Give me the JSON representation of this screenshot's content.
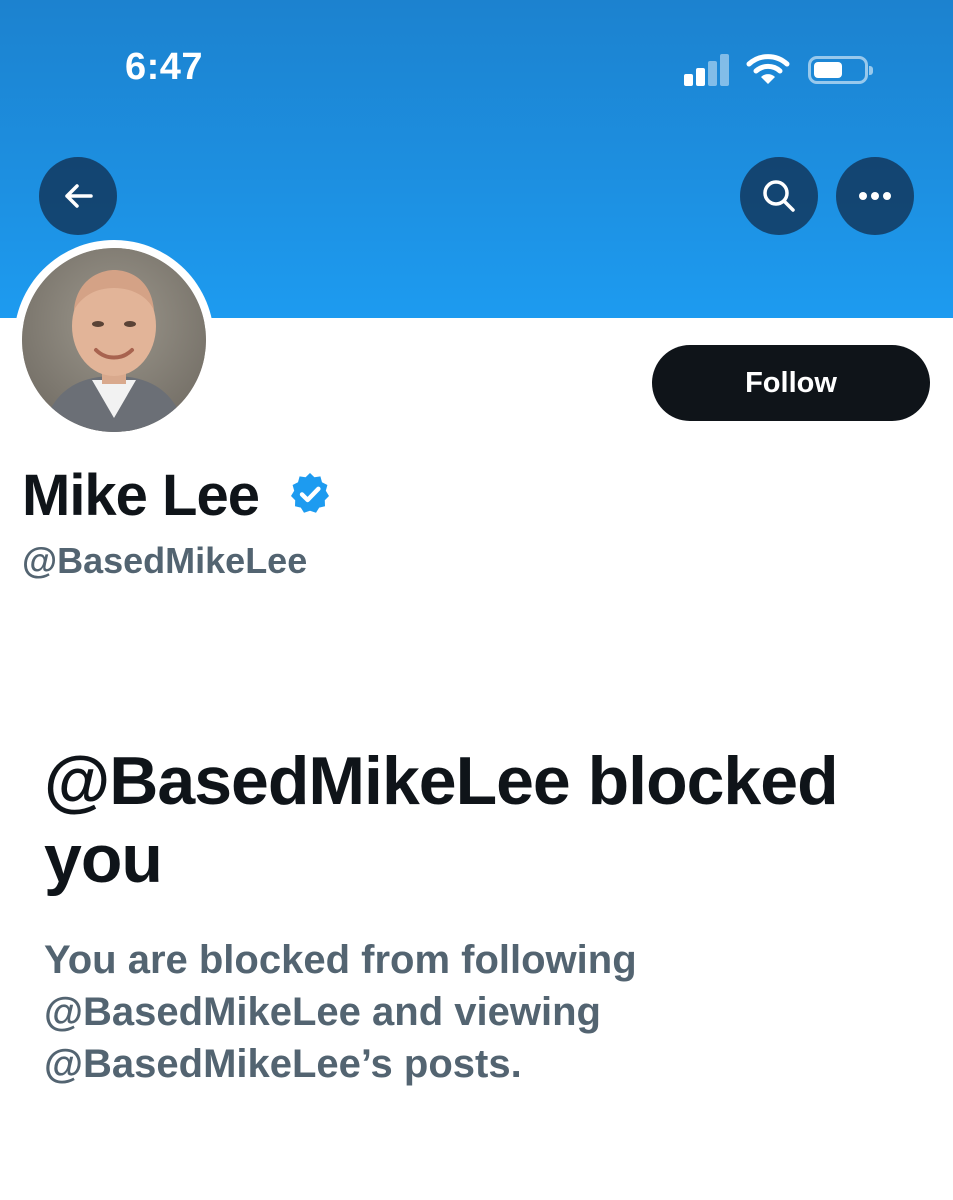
{
  "status_bar": {
    "time": "6:47",
    "signal_icon": "cellular-signal-icon",
    "wifi_icon": "wifi-icon",
    "battery_icon": "battery-icon"
  },
  "header": {
    "back_icon": "arrow-left-icon",
    "search_icon": "search-icon",
    "more_icon": "more-horizontal-icon"
  },
  "profile": {
    "display_name": "Mike Lee",
    "handle": "@BasedMikeLee",
    "verified_icon": "verified-badge-icon",
    "follow_label": "Follow"
  },
  "blocked": {
    "title": "@BasedMikeLee blocked you",
    "description": "You are blocked from following @BasedMikeLee and viewing @BasedMikeLee’s posts."
  },
  "colors": {
    "banner": "#1d9bf0",
    "text_primary": "#0f1419",
    "text_secondary": "#536471",
    "verified": "#1d9bf0",
    "button_dark": "#0f1419"
  }
}
